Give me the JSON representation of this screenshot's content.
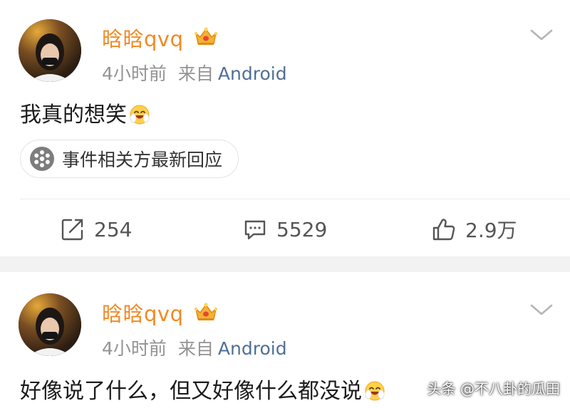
{
  "posts": [
    {
      "username": "晗晗qvq",
      "time": "4小时前",
      "source_prefix": "来自",
      "device": "Android",
      "content": "我真的想笑",
      "topic_chip": "事件相关方最新回应",
      "actions": {
        "repost": "254",
        "comment": "5529",
        "like": "2.9万"
      }
    },
    {
      "username": "晗晗qvq",
      "time": "4小时前",
      "source_prefix": "来自",
      "device": "Android",
      "content": "好像说了什么，但又好像什么都没说"
    }
  ],
  "watermark": "头条 @不八卦的瓜田",
  "colors": {
    "username": "#f08a24",
    "device_link": "#4f6f95",
    "meta": "#939393",
    "separator": "#f2f2f2"
  },
  "icons": [
    "vip-crown-icon",
    "chevron-down-icon",
    "smile-emoji-icon",
    "topic-icon",
    "repost-icon",
    "comment-icon",
    "like-icon"
  ]
}
